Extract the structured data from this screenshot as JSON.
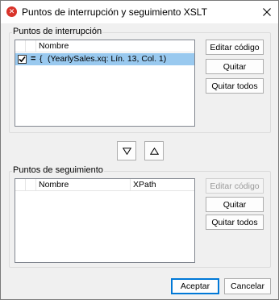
{
  "window": {
    "title": "Puntos de interrupción y seguimiento XSLT",
    "close_symbol": "×"
  },
  "breakpoints": {
    "group_label": "Puntos de interrupción",
    "column_name": "Nombre",
    "rows": [
      {
        "checked": true,
        "marker": "=",
        "brace": "{",
        "text": "(YearlySales.xq: Lín. 13, Col. 1)"
      }
    ],
    "edit_button": "Editar código",
    "remove_button": "Quitar",
    "remove_all_button": "Quitar todos"
  },
  "tracepoints": {
    "group_label": "Puntos de seguimiento",
    "column_name": "Nombre",
    "column_xpath": "XPath",
    "edit_button": "Editar código",
    "remove_button": "Quitar",
    "remove_all_button": "Quitar todos"
  },
  "footer": {
    "accept_button": "Aceptar",
    "cancel_button": "Cancelar"
  },
  "icons": {
    "app": "altova-x-icon",
    "move_down": "triangle-down-icon",
    "move_up": "triangle-up-icon"
  },
  "colors": {
    "selection": "#99c9ef",
    "default_button_border": "#0078d7",
    "app_icon": "#d9332a"
  }
}
